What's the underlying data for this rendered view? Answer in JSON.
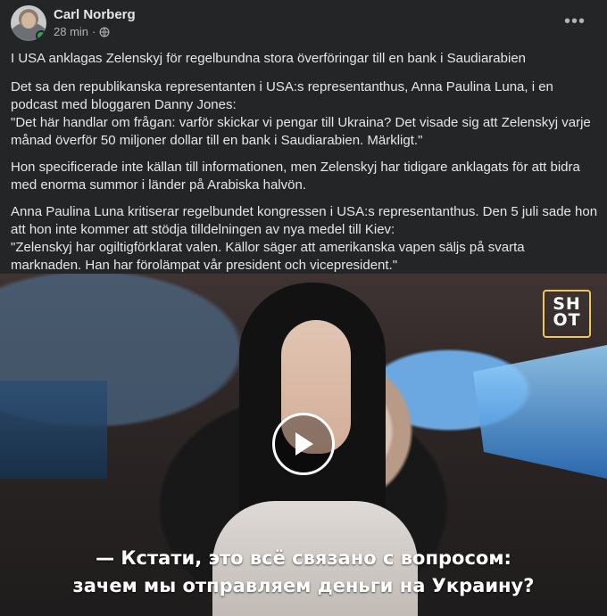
{
  "post": {
    "author": "Carl Norberg",
    "time": "28 min",
    "separator": "·",
    "more_label": "•••"
  },
  "content": {
    "p1": "I USA anklagas Zelenskyj för regelbundna stora överföringar till en bank i Saudiarabien",
    "p2_line1": "Det sa den republikanska representanten i USA:s representanthus, Anna Paulina Luna, i en podcast med bloggaren Danny Jones:",
    "p2_line2": "\"Det här handlar om frågan: varför skickar vi pengar till Ukraina? Det visade sig att Zelenskyj varje månad överför 50 miljoner dollar till en bank i Saudiarabien. Märkligt.\"",
    "p3": "Hon specificerade inte källan till informationen, men Zelenskyj har tidigare anklagats för att bidra med enorma summor i länder på Arabiska halvön.",
    "p4_line1": "Anna Paulina Luna kritiserar regelbundet kongressen i USA:s representanthus. Den 5 juli sade hon att hon inte kommer att stödja tilldelningen av nya medel till Kiev:",
    "p4_line2": "\"Zelenskyj har ogiltigförklarat valen. Källor säger att amerikanska vapen säljs på svarta marknaden. Han har förolämpat vår president och vicepresident.\""
  },
  "video": {
    "logo_line1": "SH",
    "logo_line2": "OT",
    "subtitle_line1": "— Кстати, это всё связано с вопросом:",
    "subtitle_line2": "зачем мы отправляем деньги на Украину?"
  },
  "icons": {
    "privacy": "globe-icon",
    "menu": "more-horizontal-icon",
    "play": "play-icon"
  },
  "colors": {
    "background": "#242526",
    "text": "#e4e6eb",
    "muted": "#b0b3b8",
    "online": "#31a24c",
    "logo_accent": "#f0c55a"
  }
}
